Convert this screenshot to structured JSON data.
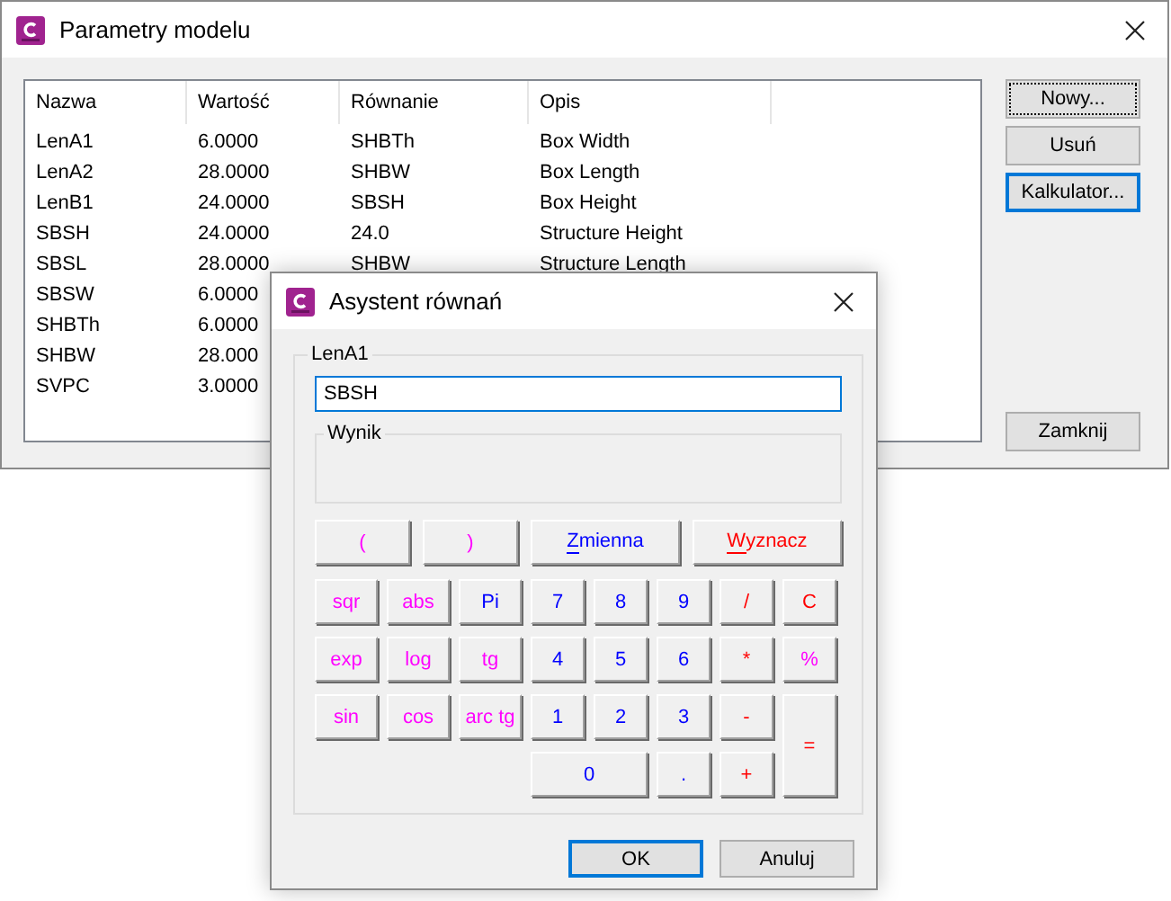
{
  "main_window": {
    "title": "Parametry modelu",
    "table": {
      "columns": [
        "Nazwa",
        "Wartość",
        "Równanie",
        "Opis"
      ],
      "rows": [
        {
          "cells": [
            "LenA1",
            "6.0000",
            "SHBTh",
            "Box Width"
          ]
        },
        {
          "cells": [
            "LenA2",
            "28.0000",
            "SHBW",
            "Box Length"
          ]
        },
        {
          "cells": [
            "LenB1",
            "24.0000",
            "SBSH",
            "Box Height"
          ]
        },
        {
          "cells": [
            "SBSH",
            "24.0000",
            "24.0",
            "Structure Height"
          ]
        },
        {
          "cells": [
            "SBSL",
            "28.0000",
            "SHBW",
            "Structure Length"
          ]
        },
        {
          "cells": [
            "SBSW",
            "6.0000"
          ]
        },
        {
          "cells": [
            "SHBTh",
            "6.0000"
          ]
        },
        {
          "cells": [
            "SHBW",
            "28.000"
          ]
        },
        {
          "cells": [
            "SVPC",
            "3.0000"
          ]
        }
      ]
    },
    "buttons": [
      {
        "label": "Nowy...",
        "focused": true,
        "default": false
      },
      {
        "label": "Usuń",
        "focused": false,
        "default": false
      },
      {
        "label": "Kalkulator...",
        "focused": false,
        "default": true
      }
    ],
    "close_button": "Zamknij"
  },
  "dialog": {
    "title": "Asystent równań",
    "group_label": "LenA1",
    "expression": "SBSH",
    "result_label": "Wynik",
    "top_buttons": [
      {
        "label": "(",
        "kind": "func",
        "mnemonic": false
      },
      {
        "label": ")",
        "kind": "func",
        "mnemonic": false
      },
      {
        "label": "Zmienna",
        "kind": "digit",
        "mnemonic": true
      },
      {
        "label": "Wyznacz",
        "kind": "op",
        "mnemonic": true
      }
    ],
    "keys": [
      {
        "label": "sqr",
        "kind": "func"
      },
      {
        "label": "abs",
        "kind": "func"
      },
      {
        "label": "Pi",
        "kind": "digit"
      },
      {
        "label": "7",
        "kind": "digit"
      },
      {
        "label": "8",
        "kind": "digit"
      },
      {
        "label": "9",
        "kind": "digit"
      },
      {
        "label": "/",
        "kind": "op"
      },
      {
        "label": "C",
        "kind": "op"
      },
      {
        "label": "exp",
        "kind": "func"
      },
      {
        "label": "log",
        "kind": "func"
      },
      {
        "label": "tg",
        "kind": "func"
      },
      {
        "label": "4",
        "kind": "digit"
      },
      {
        "label": "5",
        "kind": "digit"
      },
      {
        "label": "6",
        "kind": "digit"
      },
      {
        "label": "*",
        "kind": "op"
      },
      {
        "label": "%",
        "kind": "func"
      },
      {
        "label": "sin",
        "kind": "func"
      },
      {
        "label": "cos",
        "kind": "func"
      },
      {
        "label": "arc tg",
        "kind": "func"
      },
      {
        "label": "1",
        "kind": "digit"
      },
      {
        "label": "2",
        "kind": "digit"
      },
      {
        "label": "3",
        "kind": "digit"
      },
      {
        "label": "-",
        "kind": "op"
      },
      {
        "label": "=",
        "kind": "op"
      },
      {
        "label": "0",
        "kind": "digit"
      },
      {
        "label": ".",
        "kind": "digit"
      },
      {
        "label": "+",
        "kind": "op"
      }
    ],
    "buttons": [
      {
        "label": "OK",
        "default": true
      },
      {
        "label": "Anuluj",
        "default": false
      }
    ]
  }
}
